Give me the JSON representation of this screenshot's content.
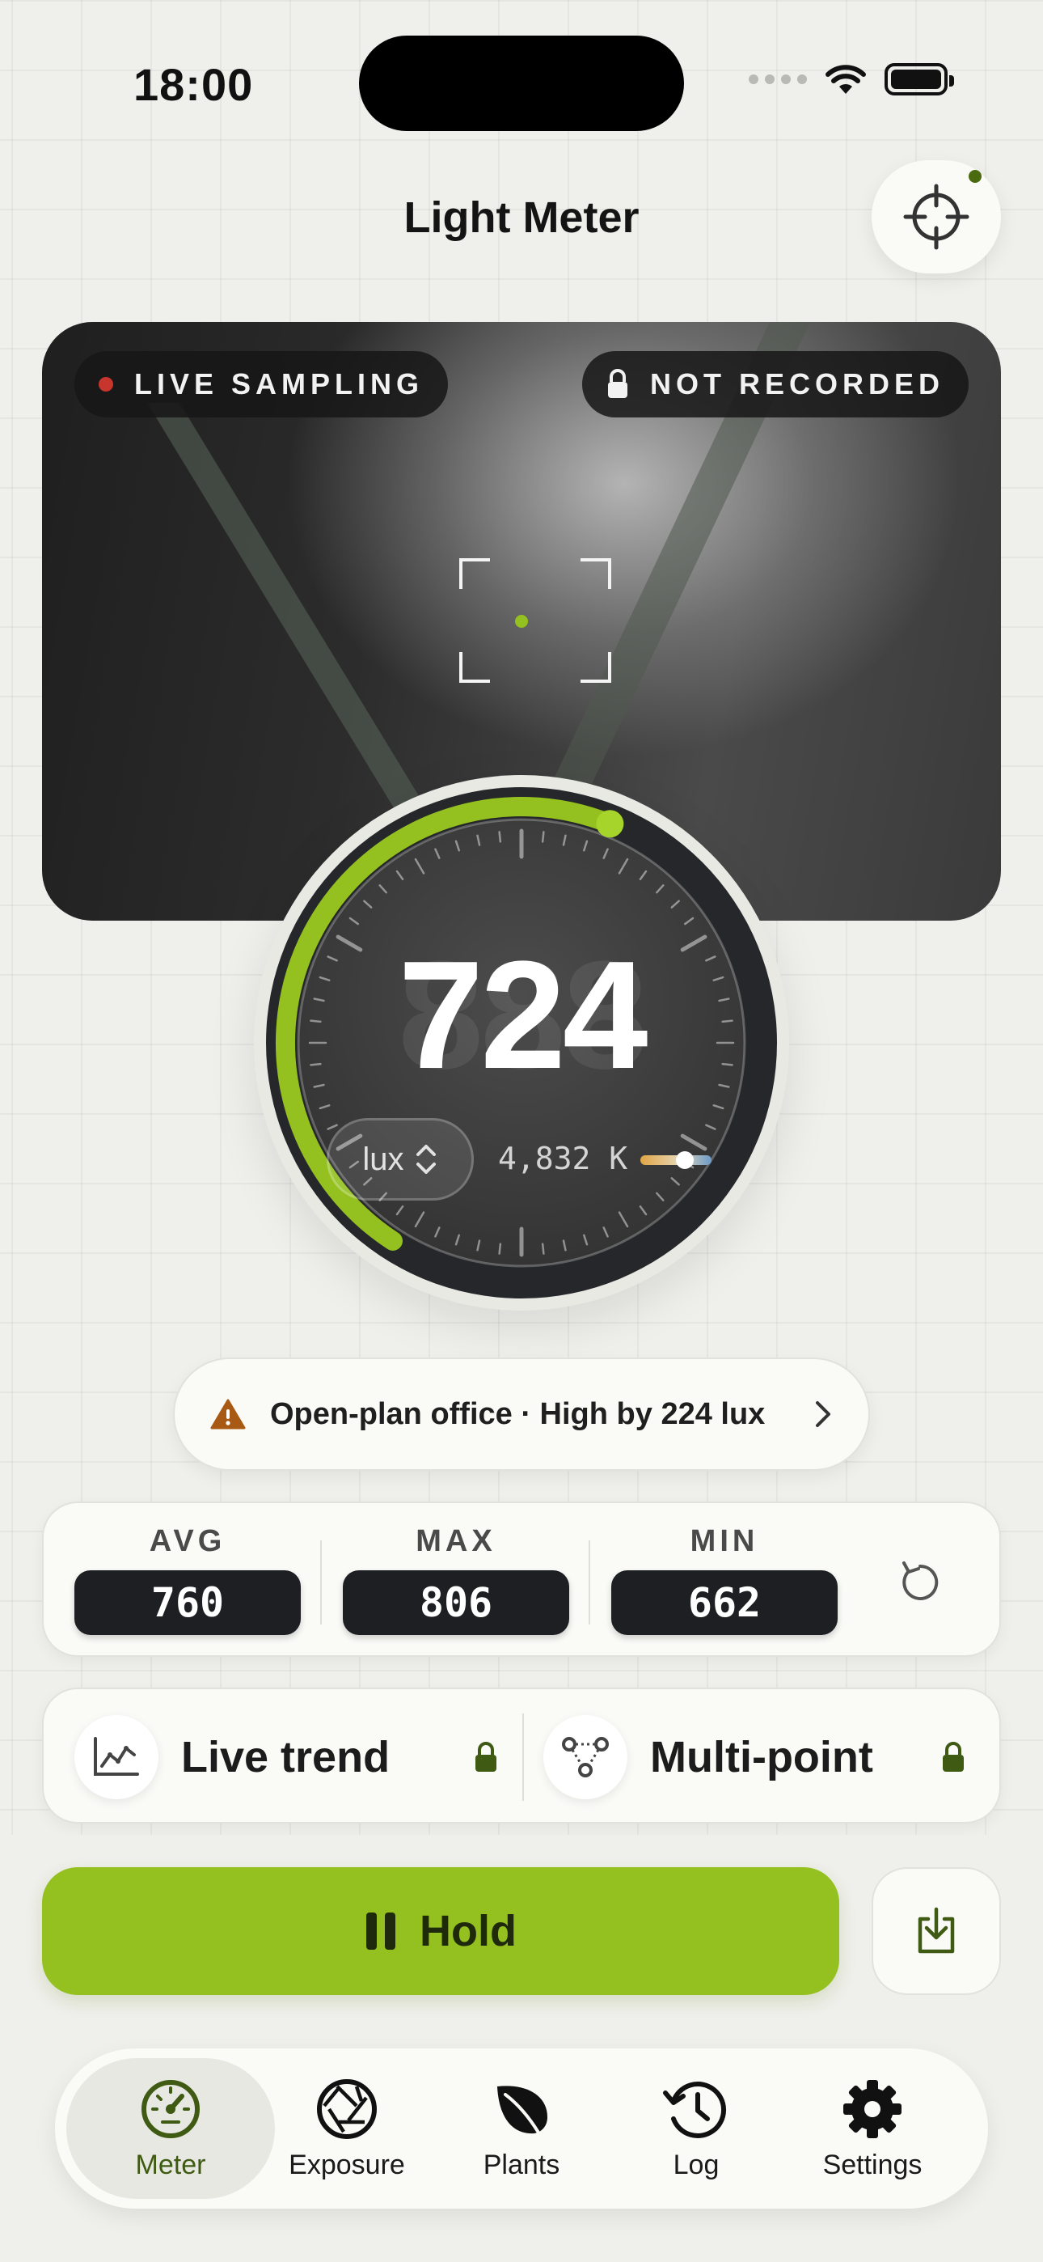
{
  "status_bar": {
    "time": "18:00"
  },
  "header": {
    "title": "Light Meter",
    "target_icon": "crosshair-icon"
  },
  "camera": {
    "live_badge": "LIVE SAMPLING",
    "recording_badge": "NOT RECORDED"
  },
  "meter": {
    "reading": "724",
    "ghost_digits": "888",
    "unit": "lux",
    "color_temp": "4,832 K",
    "color_temp_position": 0.62,
    "accent": "#94c11f"
  },
  "alert": {
    "text": "Open-plan office · High by 224 lux",
    "icon": "warning-icon",
    "color": "#a85a14"
  },
  "stats": {
    "avg": {
      "label": "AVG",
      "value": "760"
    },
    "max": {
      "label": "MAX",
      "value": "806"
    },
    "min": {
      "label": "MIN",
      "value": "662"
    }
  },
  "features": {
    "trend": {
      "label": "Live trend",
      "icon": "chart-line-icon",
      "locked": true
    },
    "multipoint": {
      "label": "Multi-point",
      "icon": "multi-point-icon",
      "locked": true
    }
  },
  "actions": {
    "hold_label": "Hold",
    "export_icon": "export-icon"
  },
  "tabs": [
    {
      "label": "Meter",
      "icon": "gauge-icon",
      "active": true
    },
    {
      "label": "Exposure",
      "icon": "aperture-icon",
      "active": false
    },
    {
      "label": "Plants",
      "icon": "leaf-icon",
      "active": false
    },
    {
      "label": "Log",
      "icon": "history-icon",
      "active": false
    },
    {
      "label": "Settings",
      "icon": "gear-icon",
      "active": false
    }
  ]
}
